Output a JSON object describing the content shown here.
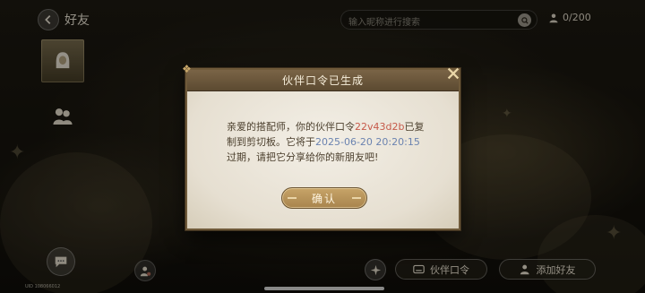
{
  "header": {
    "title": "好友",
    "search_placeholder": "输入昵称进行搜索",
    "friend_count": "0/200"
  },
  "sidebar": {
    "tabs": [
      {
        "name": "friends-tab",
        "icon": "girl-avatar-icon",
        "active": true
      },
      {
        "name": "group-tab",
        "icon": "two-people-icon",
        "active": false
      }
    ]
  },
  "footer": {
    "uid": "UID 10806601​2",
    "partner_code_label": "伙伴口令",
    "add_friend_label": "添加好友"
  },
  "dialog": {
    "title": "伙伴口令已生成",
    "msg_1": "亲爱的搭配师，你的伙伴口令",
    "code": "22v43d2b",
    "msg_2": "已复制到剪切板。它将于",
    "date": "2025-06-20 20:20:15",
    "msg_3": "过期，请把它分享给你的新朋友吧!",
    "confirm_label": "确认"
  },
  "colors": {
    "code": "#c65a4a",
    "date": "#6b83b0",
    "header_bar": "#5c4a31",
    "button": "#b5925a"
  }
}
